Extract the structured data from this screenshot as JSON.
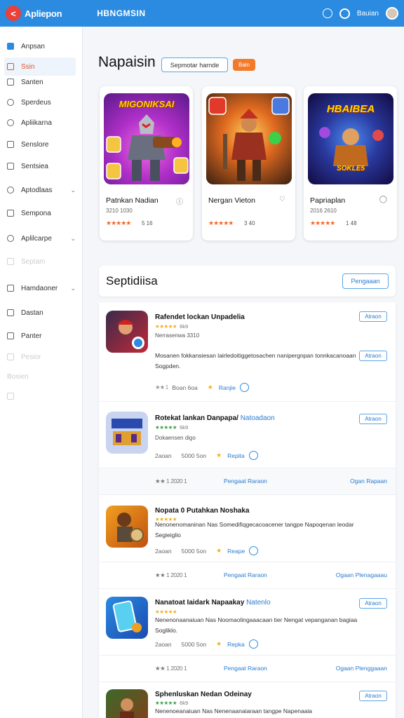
{
  "topbar": {
    "app_title": "Apliepon",
    "center_title": "HBNGMSIN",
    "user_label": "Bauian",
    "logo_icon": "app-logo"
  },
  "sidebar": {
    "items": [
      {
        "label": "Anpsan"
      },
      {
        "label": "Ssin"
      },
      {
        "label": "Santen"
      },
      {
        "label": "Sperdeus"
      },
      {
        "label": "Apliikarna"
      },
      {
        "label": "Senslore"
      },
      {
        "label": "Sentsiea"
      },
      {
        "label": "Aptodlaas"
      },
      {
        "label": "Sempona"
      },
      {
        "label": "Aplilcarpe"
      },
      {
        "label": "Septam"
      },
      {
        "label": "Hamdaoner"
      },
      {
        "label": "Dastan"
      },
      {
        "label": "Panter"
      },
      {
        "label": "Pesior"
      },
      {
        "label": "Bosien"
      }
    ]
  },
  "header": {
    "title": "Napaisin",
    "search_placeholder": "Sepmotar harnde",
    "tag": "Bain"
  },
  "featured": [
    {
      "art_title": "MIGONIKSAI",
      "name": "Patnkan Nadian",
      "sub": "3210 1030",
      "rating": "5 16",
      "stars": "★★★★★"
    },
    {
      "art_title": "",
      "name": "Nergan Vieton",
      "sub": "",
      "rating": "3 40",
      "stars": "★★★★★"
    },
    {
      "art_title": "HBAIBEA",
      "art_subtitle": "SOKLE5",
      "name": "Papriaplan",
      "sub": "2016 2610",
      "rating": "1 48",
      "stars": "★★★★★"
    }
  ],
  "section": {
    "title": "Septidiisa",
    "button": "Pengaaan"
  },
  "list": [
    {
      "name": "Rafendet lockan Unpadelia",
      "name_hl": "",
      "stars": "★★★★★",
      "stars_num": "6k9",
      "sub": "Nerrasenwa 3310",
      "desc": "Mosanen fokkansiesan lairledoitiggetosachen nanipergnpan tonnkacanoaan Sogpden.",
      "button": "Atraon",
      "button2": "Atraon",
      "meta": {
        "g": "★★ 1",
        "a": "Boan 6oa",
        "link": "Ranjie"
      }
    },
    {
      "name": "Rotekat lankan Danpapa/",
      "name_hl": "Natoadaon",
      "stars": "★★★★★",
      "stars_num": "6k9",
      "sub": "Dokaensen digo",
      "desc": "",
      "button": "Atraon",
      "meta": {
        "g": "2aoan",
        "a": "5000 5on",
        "link": "Repita"
      },
      "foot": {
        "a": "★★ 1    2020 1",
        "b": "Pengaat Raraon",
        "c": "Ogan Rapaan"
      }
    },
    {
      "name": "Nopata 0 Putahkan Noshaka",
      "name_hl": "",
      "stars": "★★★★★",
      "stars_num": "",
      "sub": "",
      "desc": "Nenonenomaninan Nas Somedifiqgecacoacener tangpe Napoqenan leodar Segieiglio",
      "button": "",
      "meta": {
        "g": "2aoan",
        "a": "5000 5on",
        "link": "Reape"
      },
      "foot": {
        "a": "★★ 1    2020 1",
        "b": "Pengaat Raraon",
        "c": "Ogaan Plenagaaau"
      }
    },
    {
      "name": "Nanatoat Iaidark Napaakay",
      "name_hl": "Natenlo",
      "stars": "★★★★★",
      "stars_num": "",
      "sub": "",
      "desc": "Nenenonaanaiuan Nas Noomaolingaaacaan tier Nengat vepanganan bagiaa Sogliklo.",
      "button": "Atraon",
      "meta": {
        "g": "2aoan",
        "a": "5000 5on",
        "link": "Repka"
      },
      "foot": {
        "a": "★★ 1    2020 1",
        "b": "Pengaat Raraon",
        "c": "Ogaan Plenggaaan"
      }
    },
    {
      "name": "Sphenluskan Nedan Odeinay",
      "name_hl": "",
      "stars": "★★★★★",
      "stars_num": "6k9",
      "sub": "",
      "desc": "Nenenoeanaiuan Nas Nenenaanaiaraan tangpe Napenaaia",
      "button": "Atraon",
      "meta": {}
    }
  ],
  "colors": {
    "topbar": "#2a8be0",
    "accent_orange": "#f27a2a",
    "link_blue": "#2a7bd0",
    "star_orange": "#f06b2a",
    "star_gold": "#f2b01e"
  }
}
